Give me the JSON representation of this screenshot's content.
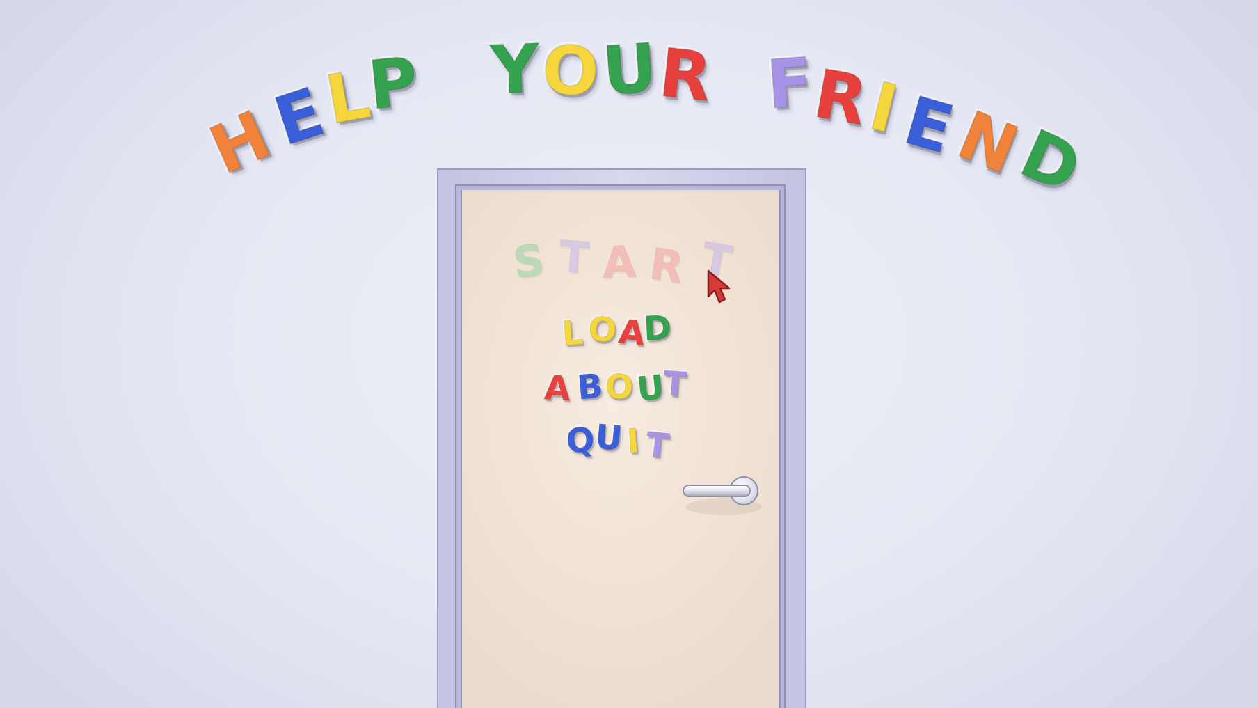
{
  "title": {
    "text": "HELP YOUR FRIEND",
    "letters": [
      {
        "char": "H",
        "color": "#f0823a"
      },
      {
        "char": "E",
        "color": "#3a5fd8"
      },
      {
        "char": "L",
        "color": "#f5d63c"
      },
      {
        "char": "P",
        "color": "#34a24e"
      },
      {
        "char": "Y",
        "color": "#34a24e"
      },
      {
        "char": "O",
        "color": "#f5d63c"
      },
      {
        "char": "U",
        "color": "#34a24e"
      },
      {
        "char": "R",
        "color": "#e8413d"
      },
      {
        "char": "F",
        "color": "#a894e6"
      },
      {
        "char": "R",
        "color": "#e8413d"
      },
      {
        "char": "I",
        "color": "#f5d63c"
      },
      {
        "char": "E",
        "color": "#3a5fd8"
      },
      {
        "char": "N",
        "color": "#f0823a"
      },
      {
        "char": "D",
        "color": "#34a24e"
      }
    ]
  },
  "menu": {
    "items": [
      {
        "id": "start",
        "label": "START",
        "highlighted": true,
        "letters": [
          {
            "char": "S",
            "color": "#8fd6a0"
          },
          {
            "char": "T",
            "color": "#c4b6ee"
          },
          {
            "char": "A",
            "color": "#f4a0a0"
          },
          {
            "char": "R",
            "color": "#f4a0a0"
          },
          {
            "char": "T",
            "color": "#c4b6ee"
          }
        ]
      },
      {
        "id": "load",
        "label": "LOAD",
        "highlighted": false,
        "letters": [
          {
            "char": "L",
            "color": "#f5d63c"
          },
          {
            "char": "O",
            "color": "#f5d63c"
          },
          {
            "char": "A",
            "color": "#e8413d"
          },
          {
            "char": "D",
            "color": "#34a24e"
          }
        ]
      },
      {
        "id": "about",
        "label": "ABOUT",
        "highlighted": false,
        "letters": [
          {
            "char": "A",
            "color": "#e8413d"
          },
          {
            "char": "B",
            "color": "#3a5fd8"
          },
          {
            "char": "O",
            "color": "#f5d63c"
          },
          {
            "char": "U",
            "color": "#34a24e"
          },
          {
            "char": "T",
            "color": "#a894e6"
          }
        ]
      },
      {
        "id": "quit",
        "label": "QUIT",
        "highlighted": false,
        "letters": [
          {
            "char": "Q",
            "color": "#3a5fd8"
          },
          {
            "char": "U",
            "color": "#3a5fd8"
          },
          {
            "char": "I",
            "color": "#f5d63c"
          },
          {
            "char": "T",
            "color": "#a894e6"
          }
        ]
      }
    ]
  },
  "cursor": {
    "icon": "pointer-arrow-icon",
    "color": "#d83a3a"
  }
}
